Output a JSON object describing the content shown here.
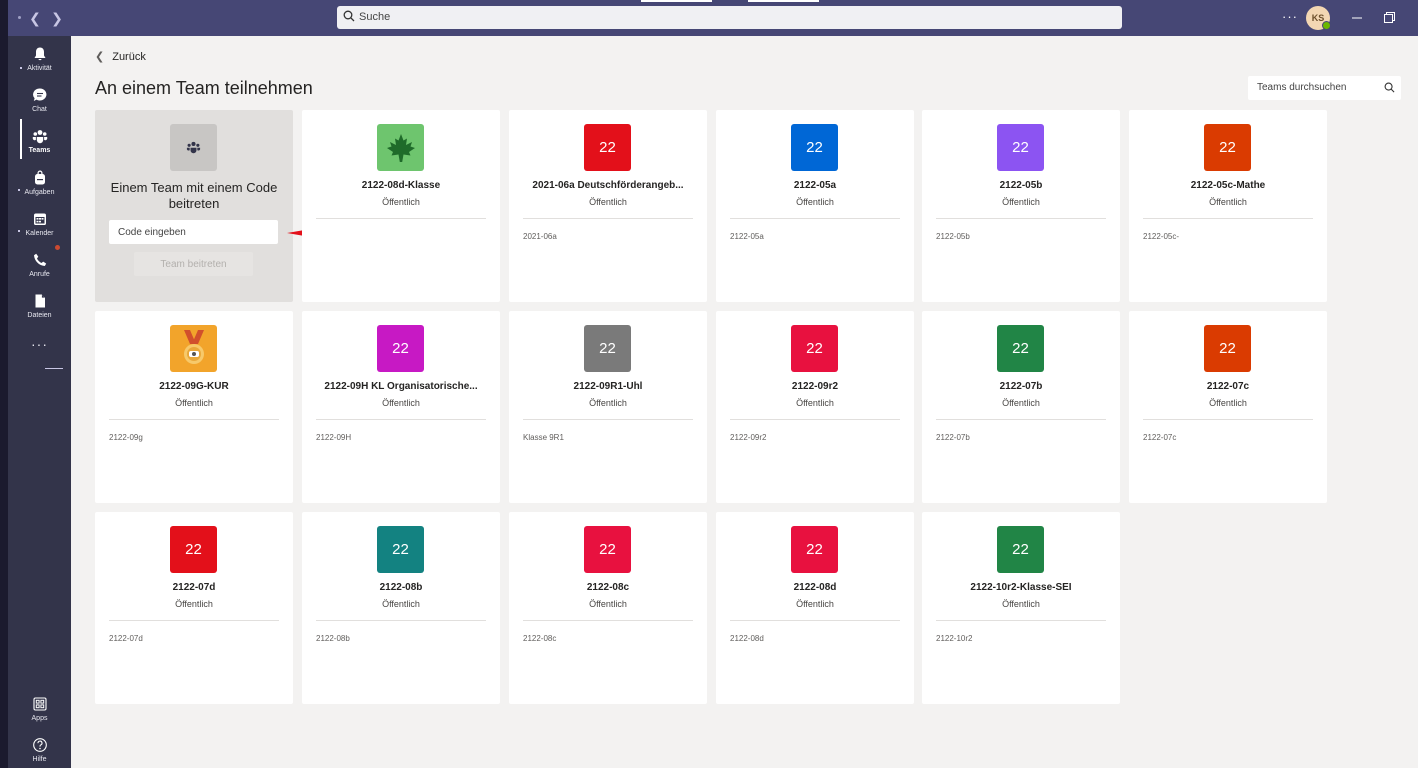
{
  "titlebar": {
    "search_placeholder": "Suche",
    "avatar_initials": "KS"
  },
  "rail": {
    "items": [
      {
        "label": "Aktivität"
      },
      {
        "label": "Chat"
      },
      {
        "label": "Teams"
      },
      {
        "label": "Aufgaben"
      },
      {
        "label": "Kalender"
      },
      {
        "label": "Anrufe"
      },
      {
        "label": "Dateien"
      },
      {
        "label": "Apps"
      },
      {
        "label": "Hilfe"
      }
    ],
    "more_label": "···",
    "active_item": "Teams"
  },
  "main": {
    "back_label": "Zurück",
    "title": "An einem Team teilnehmen",
    "team_search_placeholder": "Teams durchsuchen",
    "join_card": {
      "title": "Einem Team mit einem Code beitreten",
      "input_placeholder": "Code eingeben",
      "button_label": "Team beitreten"
    },
    "teams": [
      {
        "name": "2122-08d-Klasse",
        "visibility": "Öffentlich",
        "description": "",
        "tile_text": "",
        "tile_color": "#6ec56e",
        "icon": "maple-leaf-icon"
      },
      {
        "name": "2021-06a Deutschförderangeb...",
        "visibility": "Öffentlich",
        "description": "2021-06a",
        "tile_text": "22",
        "tile_color": "#e3101a"
      },
      {
        "name": "2122-05a",
        "visibility": "Öffentlich",
        "description": "2122-05a",
        "tile_text": "22",
        "tile_color": "#0067d6"
      },
      {
        "name": "2122-05b",
        "visibility": "Öffentlich",
        "description": "2122-05b",
        "tile_text": "22",
        "tile_color": "#8c54f2"
      },
      {
        "name": "2122-05c-Mathe",
        "visibility": "Öffentlich",
        "description": "2122-05c-",
        "tile_text": "22",
        "tile_color": "#da3b01"
      },
      {
        "name": "2122-09G-KÜR",
        "visibility": "Öffentlich",
        "description": "2122-09g",
        "tile_text": "",
        "tile_color": "#f2a42b",
        "icon": "medal-icon"
      },
      {
        "name": "2122-09H KL Organisatorische...",
        "visibility": "Öffentlich",
        "description": "2122-09H",
        "tile_text": "22",
        "tile_color": "#c719c4"
      },
      {
        "name": "2122-09R1-Uhl",
        "visibility": "Öffentlich",
        "description": "Klasse 9R1",
        "tile_text": "22",
        "tile_color": "#7a7a7a"
      },
      {
        "name": "2122-09r2",
        "visibility": "Öffentlich",
        "description": "2122-09r2",
        "tile_text": "22",
        "tile_color": "#e8113f"
      },
      {
        "name": "2122-07b",
        "visibility": "Öffentlich",
        "description": "2122-07b",
        "tile_text": "22",
        "tile_color": "#218546"
      },
      {
        "name": "2122-07c",
        "visibility": "Öffentlich",
        "description": "2122-07c",
        "tile_text": "22",
        "tile_color": "#da3b01"
      },
      {
        "name": "2122-07d",
        "visibility": "Öffentlich",
        "description": "2122-07d",
        "tile_text": "22",
        "tile_color": "#e3101a"
      },
      {
        "name": "2122-08b",
        "visibility": "Öffentlich",
        "description": "2122-08b",
        "tile_text": "22",
        "tile_color": "#138281"
      },
      {
        "name": "2122-08c",
        "visibility": "Öffentlich",
        "description": "2122-08c",
        "tile_text": "22",
        "tile_color": "#e8113f"
      },
      {
        "name": "2122-08d",
        "visibility": "Öffentlich",
        "description": "2122-08d",
        "tile_text": "22",
        "tile_color": "#e8113f"
      },
      {
        "name": "2122-10r2-Klasse-SEI",
        "visibility": "Öffentlich",
        "description": "2122-10r2",
        "tile_text": "22",
        "tile_color": "#218546"
      }
    ]
  },
  "colors": {
    "titlebar": "#464775",
    "rail": "#33344a",
    "background": "#f3f2f1",
    "annotation_arrow": "#e3101a"
  }
}
